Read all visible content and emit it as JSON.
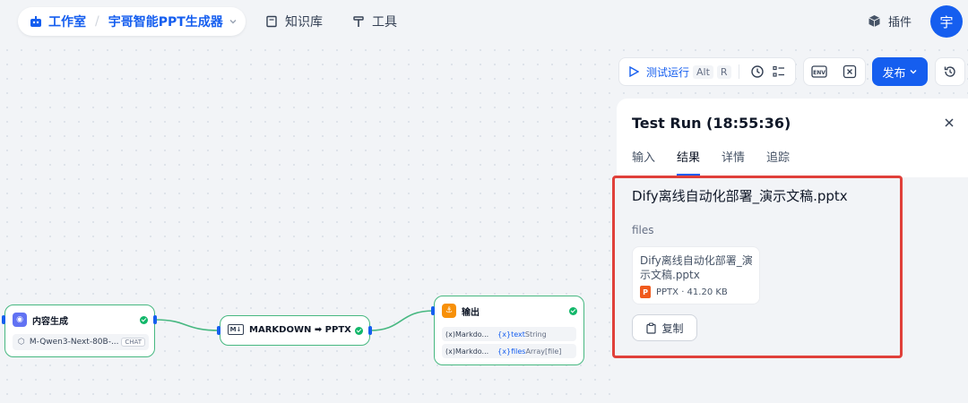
{
  "nav": {
    "workspace": "工作室",
    "app_name": "宇哥智能PPT生成器",
    "knowledge": "知识库",
    "tools": "工具",
    "plugins": "插件",
    "avatar": "宇"
  },
  "toolbar": {
    "run_label": "测试运行",
    "shortcut_alt": "Alt",
    "shortcut_r": "R",
    "publish": "发布"
  },
  "panel": {
    "title": "Test Run (18:55:36)",
    "tabs": [
      "输入",
      "结果",
      "详情",
      "追踪"
    ],
    "active_tab": "结果",
    "result_title": "Dify离线自动化部署_演示文稿.pptx",
    "files_label": "files",
    "file_card": {
      "name": "Dify离线自动化部署_演示文稿.pptx",
      "icon_text": "P",
      "meta": "PPTX · 41.20 KB"
    },
    "copy_label": "复制"
  },
  "nodes": {
    "gen": {
      "title": "内容生成",
      "model": "M-Qwen3-Next-80B-...",
      "badge": "CHAT"
    },
    "md": {
      "title": "MARKDOWN ➡ PPTX",
      "icon": "M↓"
    },
    "out": {
      "title": "输出",
      "rows": [
        {
          "name": "(x)Markdo...",
          "var": "{x}text",
          "type": "String"
        },
        {
          "name": "(x)Markdo...",
          "var": "{x}files",
          "type": "Array[file]"
        }
      ]
    }
  },
  "colors": {
    "accent": "#155eef",
    "success": "#12b76a",
    "highlight": "#e0403a",
    "edge": "#47b881"
  }
}
